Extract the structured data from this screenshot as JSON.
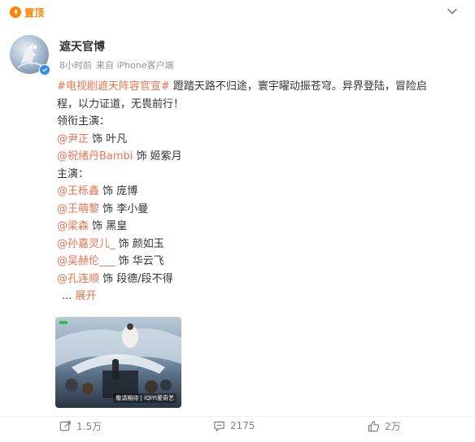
{
  "pinned": {
    "label": "置顶",
    "icon": "pin-icon"
  },
  "more_icon": "chevron-down-icon",
  "author": {
    "name": "遮天官博",
    "avatar_icon": "avatar",
    "verified_icon": "verified-badge-icon"
  },
  "meta": {
    "time": "8小时前",
    "source": "来自 iPhone客户端"
  },
  "post": {
    "hashtag": "#电视剧遮天阵容官宣#",
    "line1_rest": " 蹬踏天路不归途，寰宇曜动振苍穹。异界登陆，冒险启",
    "line2": "程，以力证道，无畏前行！",
    "lead_heading": "领衔主演：",
    "lead_cast": [
      {
        "actor": "@尹正",
        "role": " 饰 叶凡"
      },
      {
        "actor": "@祝绪丹Bambi",
        "role": " 饰 姬紫月"
      }
    ],
    "main_heading": "主演：",
    "main_cast": [
      {
        "actor": "@王栎鑫",
        "role": " 饰 庞博"
      },
      {
        "actor": "@王萌黎",
        "role": " 饰 李小曼"
      },
      {
        "actor": "@梁森",
        "role": " 饰 黑皇"
      },
      {
        "actor": "@孙嘉灵儿_",
        "role": " 饰 颜如玉"
      },
      {
        "actor": "@吴赫伦___",
        "role": " 饰 华云飞"
      },
      {
        "actor": "@孔连顺",
        "role": " 饰 段德/段不得"
      }
    ],
    "ellipsis": "... ",
    "expand": "展开"
  },
  "media": {
    "caption": "敬请期待 | iQIYI爱奇艺"
  },
  "actions": {
    "repost": {
      "icon": "repost-icon",
      "count": "1.5万"
    },
    "comment": {
      "icon": "comment-icon",
      "count": "2175"
    },
    "like": {
      "icon": "like-icon",
      "count": "2万"
    }
  },
  "colors": {
    "link": "#eb7350",
    "pin": "#ff8200",
    "verified": "#2d8de8",
    "muted": "#939393"
  }
}
